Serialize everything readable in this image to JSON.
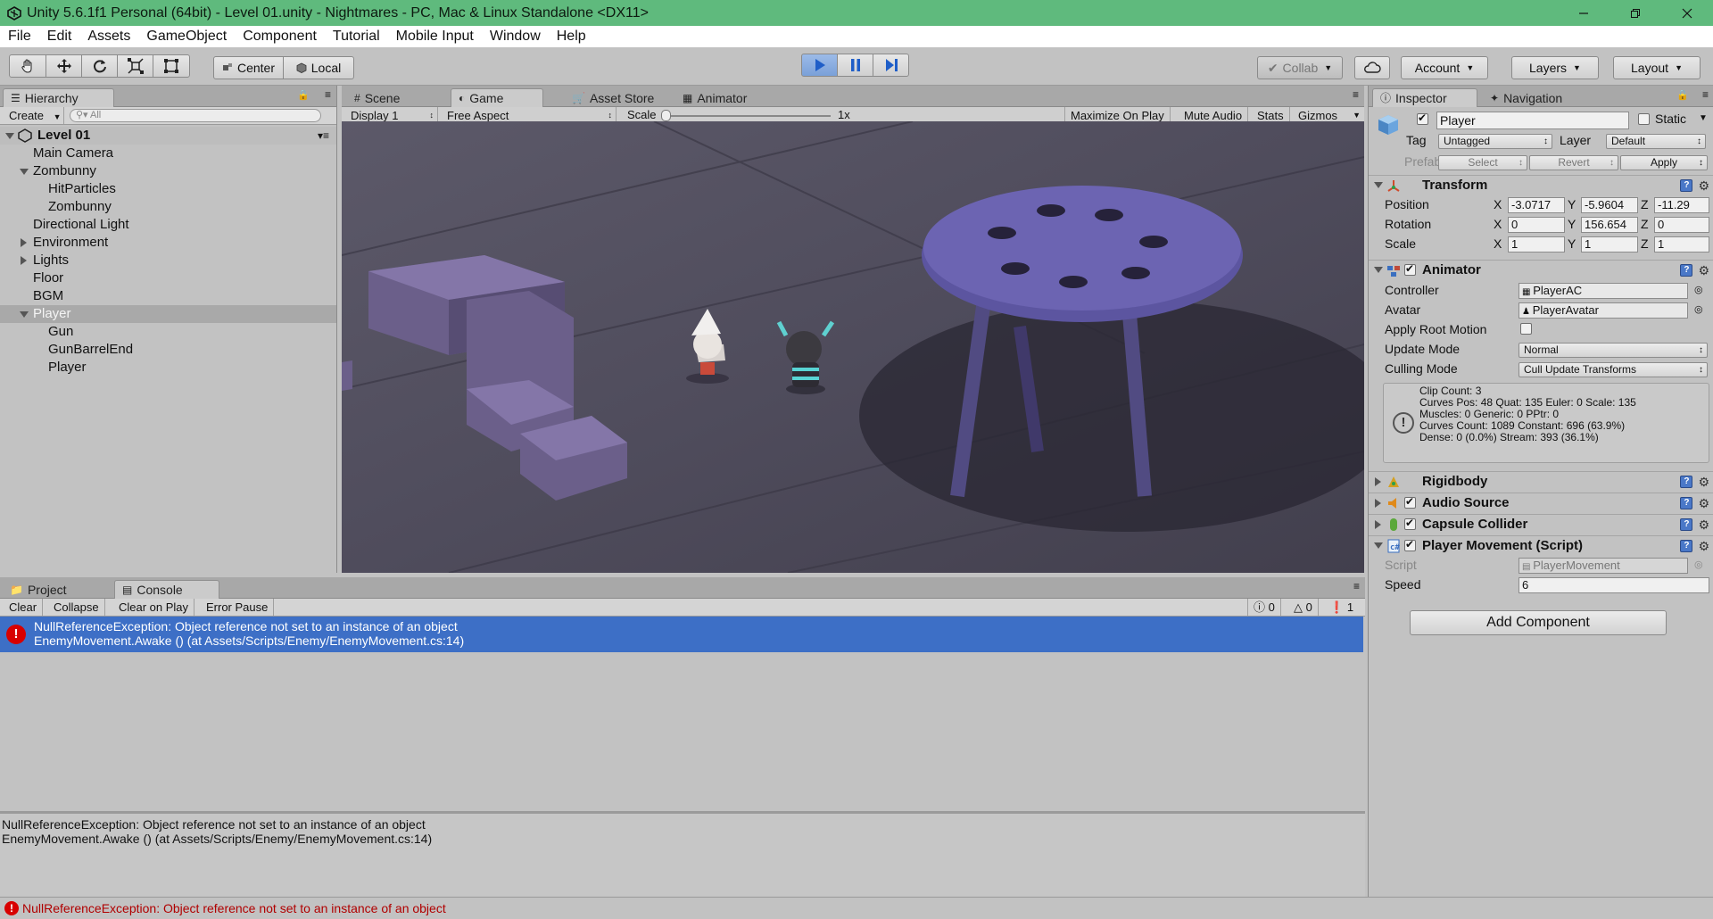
{
  "window": {
    "title": "Unity 5.6.1f1 Personal (64bit) - Level 01.unity - Nightmares - PC, Mac & Linux Standalone <DX11>"
  },
  "menu": [
    "File",
    "Edit",
    "Assets",
    "GameObject",
    "Component",
    "Tutorial",
    "Mobile Input",
    "Window",
    "Help"
  ],
  "toolbar": {
    "center_label": "Center",
    "local_label": "Local",
    "collab_label": "Collab",
    "account_label": "Account",
    "layers_label": "Layers",
    "layout_label": "Layout"
  },
  "hierarchy": {
    "tab_label": "Hierarchy",
    "create_label": "Create",
    "search_placeholder": "All",
    "scene_name": "Level 01",
    "items": [
      {
        "label": "Main Camera"
      },
      {
        "label": "Zombunny"
      },
      {
        "label": "HitParticles"
      },
      {
        "label": "Zombunny"
      },
      {
        "label": "Directional Light"
      },
      {
        "label": "Environment"
      },
      {
        "label": "Lights"
      },
      {
        "label": "Floor"
      },
      {
        "label": "BGM"
      },
      {
        "label": "Player"
      },
      {
        "label": "Gun"
      },
      {
        "label": "GunBarrelEnd"
      },
      {
        "label": "Player"
      }
    ]
  },
  "game": {
    "tabs": [
      {
        "label": "Scene"
      },
      {
        "label": "Game"
      },
      {
        "label": "Asset Store"
      },
      {
        "label": "Animator"
      }
    ],
    "display": "Display 1",
    "aspect": "Free Aspect",
    "scale_label": "Scale",
    "scale_value": "1x",
    "maximize": "Maximize On Play",
    "mute": "Mute Audio",
    "stats": "Stats",
    "gizmos": "Gizmos"
  },
  "console": {
    "tabs": [
      {
        "label": "Project"
      },
      {
        "label": "Console"
      }
    ],
    "buttons": {
      "clear": "Clear",
      "collapse": "Collapse",
      "clear_on_play": "Clear on Play",
      "error_pause": "Error Pause"
    },
    "counts": {
      "log": "0",
      "warn": "0",
      "error": "1"
    },
    "entry_line1": "NullReferenceException: Object reference not set to an instance of an object",
    "entry_line2": "EnemyMovement.Awake () (at Assets/Scripts/Enemy/EnemyMovement.cs:14)",
    "detail_line1": "NullReferenceException: Object reference not set to an instance of an object",
    "detail_line2": "EnemyMovement.Awake () (at Assets/Scripts/Enemy/EnemyMovement.cs:14)"
  },
  "inspector": {
    "tabs": [
      {
        "label": "Inspector"
      },
      {
        "label": "Navigation"
      }
    ],
    "object_name": "Player",
    "static_label": "Static",
    "tag_label": "Tag",
    "tag_value": "Untagged",
    "layer_label": "Layer",
    "layer_value": "Default",
    "prefab_label": "Prefab",
    "prefab_select": "Select",
    "prefab_revert": "Revert",
    "prefab_apply": "Apply",
    "transform": {
      "title": "Transform",
      "position_label": "Position",
      "rotation_label": "Rotation",
      "scale_label": "Scale",
      "x": "X",
      "y": "Y",
      "z": "Z",
      "position": [
        "-3.0717",
        "-5.9604",
        "-11.29"
      ],
      "rotation": [
        "0",
        "156.654",
        "0"
      ],
      "scale": [
        "1",
        "1",
        "1"
      ]
    },
    "animator": {
      "title": "Animator",
      "controller_label": "Controller",
      "controller_value": "PlayerAC",
      "avatar_label": "Avatar",
      "avatar_value": "PlayerAvatar",
      "root_motion_label": "Apply Root Motion",
      "update_mode_label": "Update Mode",
      "update_mode_value": "Normal",
      "culling_mode_label": "Culling Mode",
      "culling_mode_value": "Cull Update Transforms",
      "info": [
        "Clip Count: 3",
        "Curves Pos: 48 Quat: 135 Euler: 0 Scale: 135",
        "Muscles: 0 Generic: 0 PPtr: 0",
        "Curves Count: 1089 Constant: 696 (63.9%)",
        "Dense: 0 (0.0%) Stream: 393 (36.1%)"
      ]
    },
    "components": [
      {
        "label": "Rigidbody"
      },
      {
        "label": "Audio Source"
      },
      {
        "label": "Capsule Collider"
      },
      {
        "label": "Player Movement (Script)"
      }
    ],
    "script_label": "Script",
    "script_value": "PlayerMovement",
    "speed_label": "Speed",
    "speed_value": "6",
    "add_component": "Add Component"
  },
  "status": {
    "message": "NullReferenceException: Object reference not set to an instance of an object"
  },
  "colors": {
    "titlebar": "#5fba7d",
    "selection": "#3d6fc6",
    "play_active": "#5b8fd8",
    "error": "#c80000"
  }
}
